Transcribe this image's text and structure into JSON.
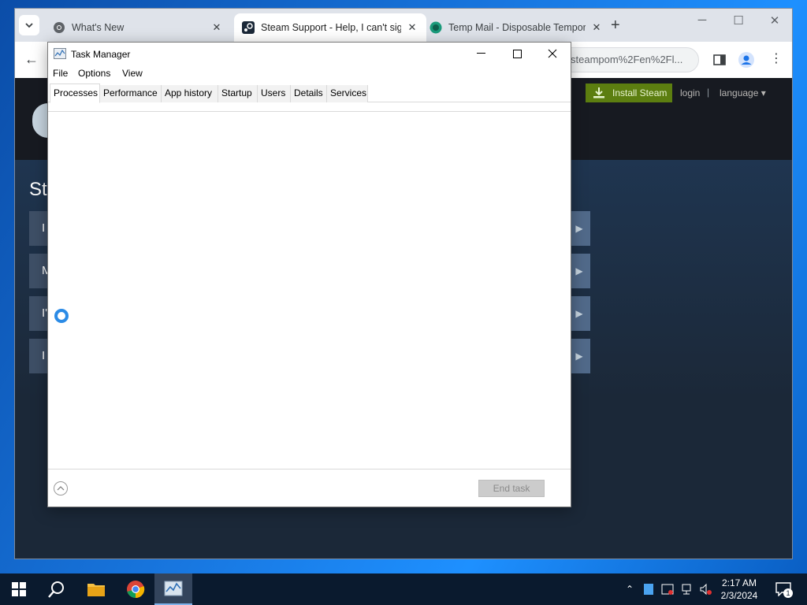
{
  "browser": {
    "tabs": [
      {
        "title": "What's New",
        "favicon": "chrome-icon",
        "active": false
      },
      {
        "title": "Steam Support - Help, I can't sign in",
        "favicon": "steam-icon",
        "active": true
      },
      {
        "title": "Temp Mail - Disposable Temporary Email",
        "favicon": "tempmail-icon",
        "active": false
      }
    ],
    "close_glyph": "✕",
    "new_tab_glyph": "+",
    "address": "steampom%2Fen%2Fl..."
  },
  "steam": {
    "install_label": "Install Steam",
    "login_label": "login",
    "separator": "|",
    "language_label": "language ▾",
    "page_title_partial": "St",
    "rows": [
      {
        "text": "I"
      },
      {
        "text": "M"
      },
      {
        "text": "I'"
      },
      {
        "text": "I"
      }
    ]
  },
  "task_manager": {
    "title": "Task Manager",
    "menu": [
      "File",
      "Options",
      "View"
    ],
    "tabs": [
      "Processes",
      "Performance",
      "App history",
      "Startup",
      "Users",
      "Details",
      "Services"
    ],
    "active_tab": "Processes",
    "end_task_label": "End task",
    "end_task_enabled": false,
    "loading": true
  },
  "taskbar": {
    "items": [
      "start-icon",
      "search-icon",
      "file-explorer-icon",
      "chrome-icon",
      "task-manager-icon"
    ],
    "active_item": "task-manager-icon",
    "clock_time": "2:17 AM",
    "clock_date": "2/3/2024",
    "notification_count": "1"
  },
  "colors": {
    "steam_green": "#5c7e10",
    "steam_dark": "#171a21",
    "spinner_blue": "#2b8be6"
  }
}
